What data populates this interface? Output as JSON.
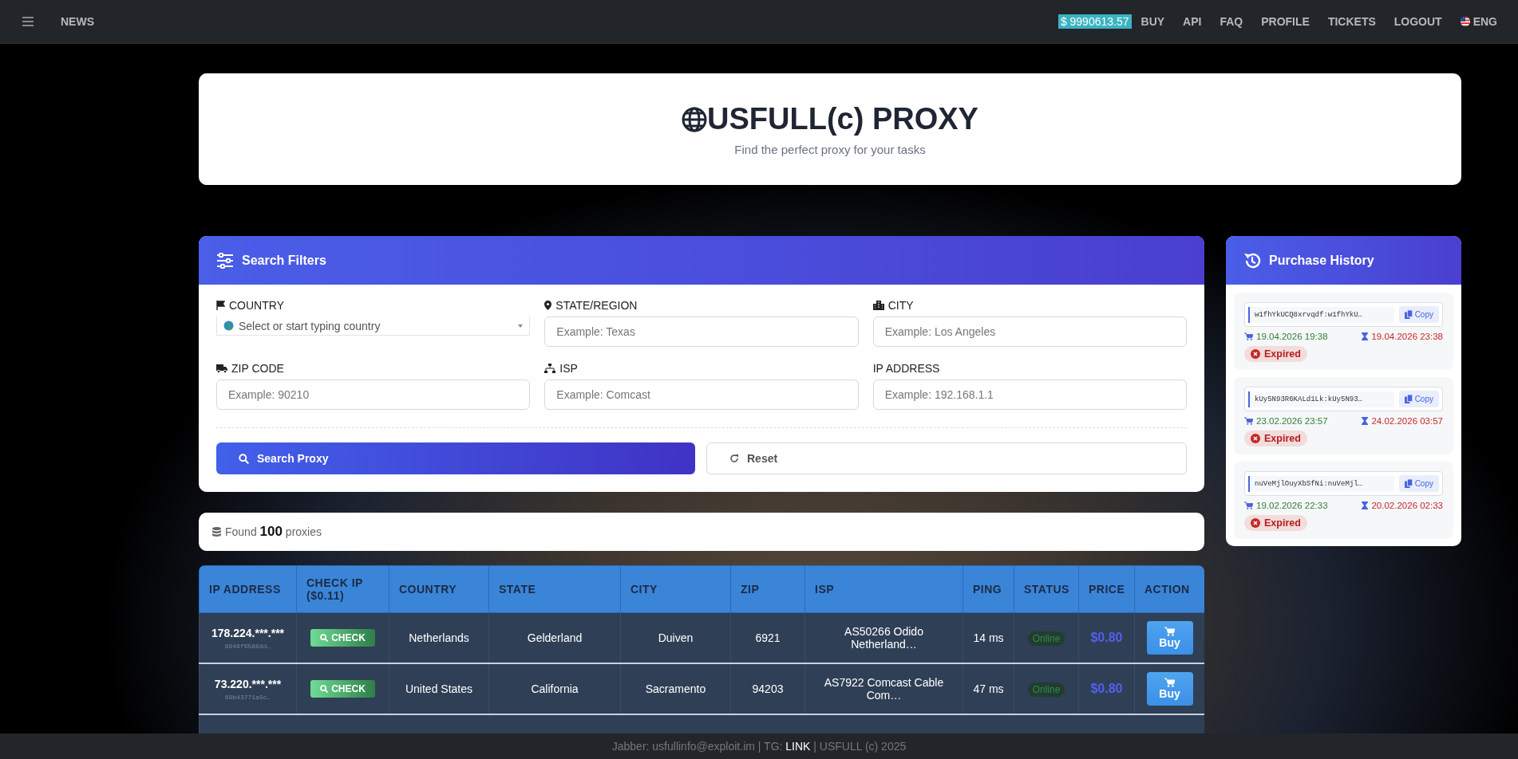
{
  "nav": {
    "left": [
      "NEWS"
    ],
    "balance": "$ 9990613.57",
    "links": [
      "BUY",
      "API",
      "FAQ",
      "PROFILE",
      "TICKETS",
      "LOGOUT"
    ],
    "language": "ENG"
  },
  "hero": {
    "title": "USFULL(c) PROXY",
    "subtitle": "Find the perfect proxy for your tasks"
  },
  "filters": {
    "title": "Search Filters",
    "fields": [
      {
        "label": "COUNTRY",
        "kind": "select",
        "placeholder": "Select or start typing country"
      },
      {
        "label": "STATE/REGION",
        "kind": "text",
        "placeholder": "Example: Texas"
      },
      {
        "label": "CITY",
        "kind": "text",
        "placeholder": "Example: Los Angeles"
      },
      {
        "label": "ZIP CODE",
        "kind": "text",
        "placeholder": "Example: 90210"
      },
      {
        "label": "ISP",
        "kind": "text",
        "placeholder": "Example: Comcast"
      },
      {
        "label": "IP ADDRESS",
        "kind": "text",
        "placeholder": "Example: 192.168.1.1"
      }
    ],
    "search_button": "Search Proxy",
    "reset_button": "Reset"
  },
  "found": {
    "before": "Found",
    "count": "100",
    "after": "proxies"
  },
  "table": {
    "columns": [
      "IP ADDRESS",
      "CHECK IP ($0.11)",
      "COUNTRY",
      "STATE",
      "CITY",
      "ZIP",
      "ISP",
      "PING",
      "STATUS",
      "PRICE",
      "ACTION"
    ],
    "rows": [
      {
        "ip": "178.224.***.***",
        "hash": "6948f65888d…",
        "check": "CHECK",
        "country": "Netherlands",
        "state": "Gelderland",
        "city": "Duiven",
        "zip": "6921",
        "isp": "AS50266 Odido Netherland…",
        "ping": "14 ms",
        "status": "Online",
        "price": "$0.80",
        "action": "Buy"
      },
      {
        "ip": "73.220.***.***",
        "hash": "69b43771a5c…",
        "check": "CHECK",
        "country": "United States",
        "state": "California",
        "city": "Sacramento",
        "zip": "94203",
        "isp": "AS7922 Comcast Cable Com…",
        "ping": "47 ms",
        "status": "Online",
        "price": "$0.80",
        "action": "Buy"
      }
    ]
  },
  "history": {
    "title": "Purchase History",
    "items": [
      {
        "key": "w1fhYkUCQ8xrvqdf:w1fhYkU…",
        "copy": "Copy",
        "bought": "19.04.2026 19:38",
        "expires": "19.04.2026 23:38",
        "status": "Expired"
      },
      {
        "key": "kUy5N93R6KALd1Lk:kUy5N93…",
        "copy": "Copy",
        "bought": "23.02.2026 23:57",
        "expires": "24.02.2026 03:57",
        "status": "Expired"
      },
      {
        "key": "nuVeMjlOuyXbSfNi:nuVeMjl…",
        "copy": "Copy",
        "bought": "19.02.2026 22:33",
        "expires": "20.02.2026 02:33",
        "status": "Expired"
      }
    ]
  },
  "footer": {
    "jabber": "Jabber: usfullinfo@exploit.im | TG:",
    "link": "LINK",
    "copyright": "| USFULL (c) 2025"
  }
}
